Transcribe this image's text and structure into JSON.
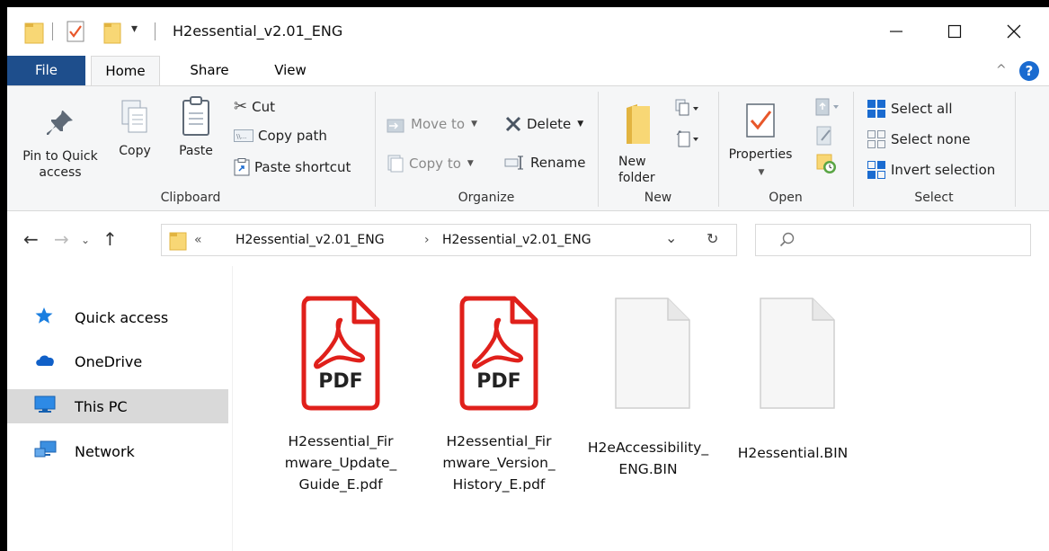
{
  "window": {
    "title": "H2essential_v2.01_ENG",
    "controls": {
      "minimize": "—",
      "maximize": "☐",
      "close": "✕"
    }
  },
  "quick_access_toolbar": {
    "dropdown": "▾"
  },
  "ribbon": {
    "tabs": [
      {
        "label": "File"
      },
      {
        "label": "Home"
      },
      {
        "label": "Share"
      },
      {
        "label": "View"
      }
    ],
    "collapse": "^",
    "help": "?",
    "clipboard": {
      "label": "Clipboard",
      "pin_label": "Pin to Quick access",
      "copy_label": "Copy",
      "paste_label": "Paste",
      "cut_label": "Cut",
      "copy_path_label": "Copy path",
      "paste_shortcut_label": "Paste shortcut"
    },
    "organize": {
      "label": "Organize",
      "move_to_label": "Move to",
      "copy_to_label": "Copy to",
      "delete_label": "Delete",
      "rename_label": "Rename"
    },
    "new": {
      "label": "New",
      "new_folder_label": "New\nfolder"
    },
    "open": {
      "label": "Open",
      "properties_label": "Properties"
    },
    "select": {
      "label": "Select",
      "select_all_label": "Select all",
      "select_none_label": "Select none",
      "invert_label": "Invert selection"
    }
  },
  "address_bar": {
    "overflow": "«",
    "crumbs": [
      "H2essential_v2.01_ENG",
      "H2essential_v2.01_ENG"
    ],
    "separator": "›",
    "dropdown": "⌄",
    "refresh": "↻"
  },
  "search": {
    "placeholder": ""
  },
  "nav_pane": {
    "items": [
      {
        "label": "Quick access",
        "icon": "star-icon"
      },
      {
        "label": "OneDrive",
        "icon": "cloud-icon"
      },
      {
        "label": "This PC",
        "icon": "monitor-icon",
        "selected": true
      },
      {
        "label": "Network",
        "icon": "network-icon"
      }
    ]
  },
  "files": [
    {
      "name": "H2essential_Fir\nmware_Update_\nGuide_E.pdf",
      "type": "pdf",
      "badge": "PDF"
    },
    {
      "name": "H2essential_Fir\nmware_Version_\nHistory_E.pdf",
      "type": "pdf",
      "badge": "PDF"
    },
    {
      "name": "H2eAccessibility_\nENG.BIN",
      "type": "blank"
    },
    {
      "name": "H2essential.BIN",
      "type": "blank"
    }
  ],
  "colors": {
    "file_tab": "#1e4e8c",
    "pdf_red": "#e0201b",
    "selection": "#d9d9d9",
    "folder": "#f8d775"
  }
}
